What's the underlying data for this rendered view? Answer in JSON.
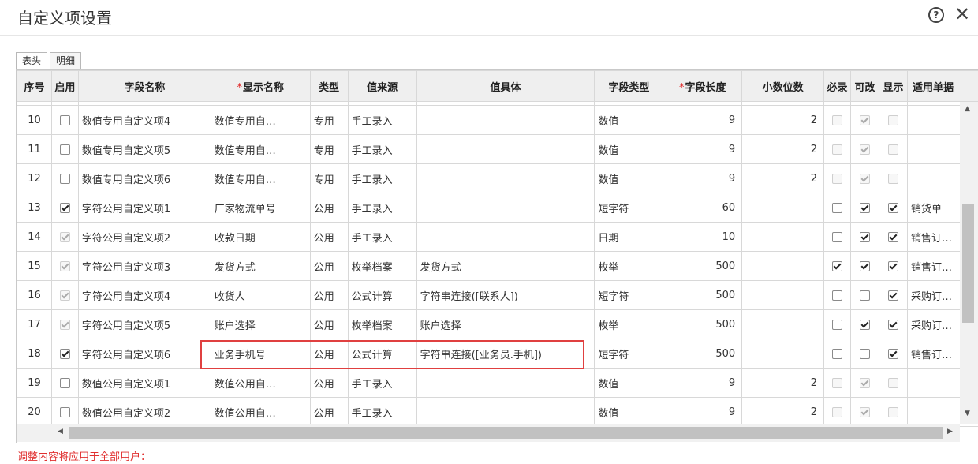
{
  "dialog": {
    "title": "自定义项设置"
  },
  "tabs": [
    "表头",
    "明细"
  ],
  "table": {
    "headers": {
      "idx": "序号",
      "enabled": "启用",
      "field_name": "字段名称",
      "display_name": "显示名称",
      "type": "类型",
      "value_source": "值来源",
      "value_detail": "值具体",
      "field_type": "字段类型",
      "field_length": "字段长度",
      "decimals": "小数位数",
      "required": "必录",
      "editable": "可改",
      "visible": "显示",
      "applicable": "适用单据"
    },
    "rows": [
      {
        "idx": "10",
        "field_name": "数值专用自定义项4",
        "display_name": "数值专用自…",
        "type": "专用",
        "value_source": "手工录入",
        "value_detail": "",
        "field_type": "数值",
        "field_length": "9",
        "decimals": "2",
        "applicable": ""
      },
      {
        "idx": "11",
        "field_name": "数值专用自定义项5",
        "display_name": "数值专用自…",
        "type": "专用",
        "value_source": "手工录入",
        "value_detail": "",
        "field_type": "数值",
        "field_length": "9",
        "decimals": "2",
        "applicable": ""
      },
      {
        "idx": "12",
        "field_name": "数值专用自定义项6",
        "display_name": "数值专用自…",
        "type": "专用",
        "value_source": "手工录入",
        "value_detail": "",
        "field_type": "数值",
        "field_length": "9",
        "decimals": "2",
        "applicable": ""
      },
      {
        "idx": "13",
        "field_name": "字符公用自定义项1",
        "display_name": "厂家物流单号",
        "type": "公用",
        "value_source": "手工录入",
        "value_detail": "",
        "field_type": "短字符",
        "field_length": "60",
        "decimals": "",
        "applicable": "销货单"
      },
      {
        "idx": "14",
        "field_name": "字符公用自定义项2",
        "display_name": "收款日期",
        "type": "公用",
        "value_source": "手工录入",
        "value_detail": "",
        "field_type": "日期",
        "field_length": "10",
        "decimals": "",
        "applicable": "销售订…"
      },
      {
        "idx": "15",
        "field_name": "字符公用自定义项3",
        "display_name": "发货方式",
        "type": "公用",
        "value_source": "枚举档案",
        "value_detail": "发货方式",
        "field_type": "枚举",
        "field_length": "500",
        "decimals": "",
        "applicable": "销售订…"
      },
      {
        "idx": "16",
        "field_name": "字符公用自定义项4",
        "display_name": "收货人",
        "type": "公用",
        "value_source": "公式计算",
        "value_detail": "字符串连接([联系人])",
        "field_type": "短字符",
        "field_length": "500",
        "decimals": "",
        "applicable": "采购订…"
      },
      {
        "idx": "17",
        "field_name": "字符公用自定义项5",
        "display_name": "账户选择",
        "type": "公用",
        "value_source": "枚举档案",
        "value_detail": "账户选择",
        "field_type": "枚举",
        "field_length": "500",
        "decimals": "",
        "applicable": "采购订…"
      },
      {
        "idx": "18",
        "field_name": "字符公用自定义项6",
        "display_name": "业务手机号",
        "type": "公用",
        "value_source": "公式计算",
        "value_detail": "字符串连接([业务员.手机])",
        "field_type": "短字符",
        "field_length": "500",
        "decimals": "",
        "applicable": "销售订…"
      },
      {
        "idx": "19",
        "field_name": "数值公用自定义项1",
        "display_name": "数值公用自…",
        "type": "公用",
        "value_source": "手工录入",
        "value_detail": "",
        "field_type": "数值",
        "field_length": "9",
        "decimals": "2",
        "applicable": ""
      },
      {
        "idx": "20",
        "field_name": "数值公用自定义项2",
        "display_name": "数值公用自…",
        "type": "公用",
        "value_source": "手工录入",
        "value_detail": "",
        "field_type": "数值",
        "field_length": "9",
        "decimals": "2",
        "applicable": ""
      }
    ]
  },
  "footer": {
    "note": "调整内容将应用于全部用户："
  }
}
